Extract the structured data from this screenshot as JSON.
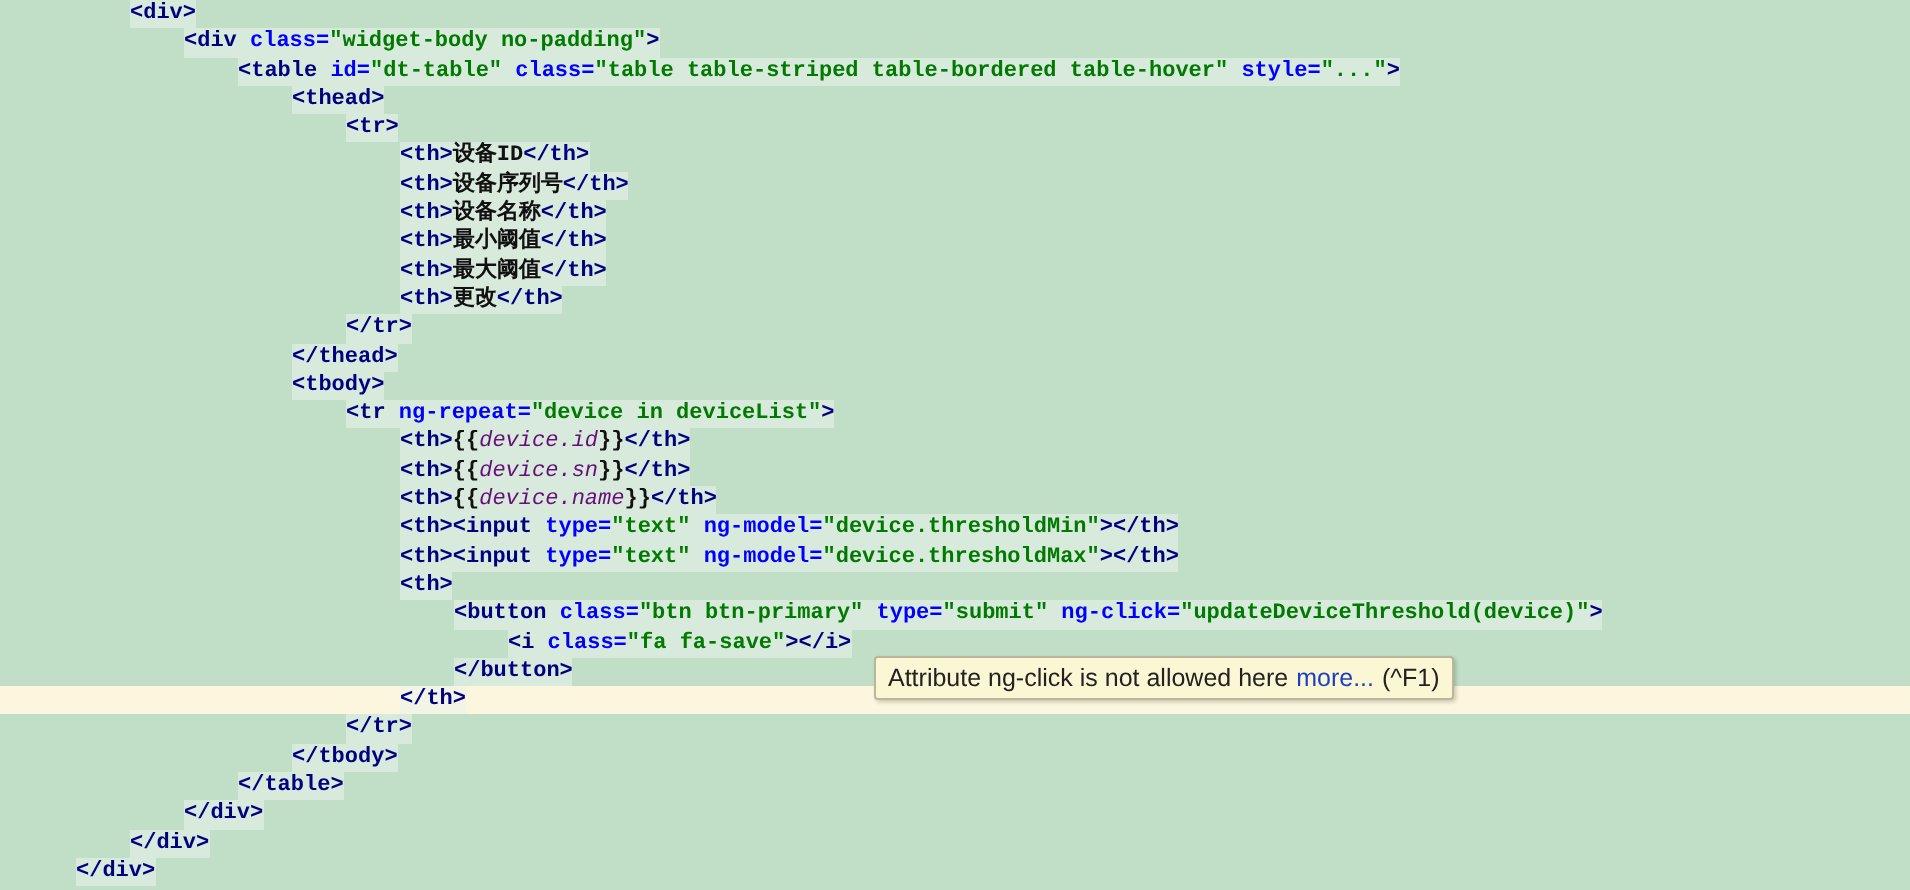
{
  "editor": {
    "lines": [
      {
        "children": [
          {
            "current": false,
            "tokens": [
              {
                "kind": "tag",
                "text": "<div>"
              }
            ],
            "children": [
              {
                "current": false,
                "tokens": [
                  {
                    "kind": "tag",
                    "text": "<div"
                  },
                  {
                    "kind": "attr",
                    "text": " class="
                  },
                  {
                    "kind": "value",
                    "text": "\"widget-body no-padding\""
                  },
                  {
                    "kind": "tag",
                    "text": ">"
                  }
                ],
                "children": [
                  {
                    "current": false,
                    "tokens": [
                      {
                        "kind": "tag",
                        "text": "<table"
                      },
                      {
                        "kind": "attr",
                        "text": " id="
                      },
                      {
                        "kind": "value",
                        "text": "\"dt-table\""
                      },
                      {
                        "kind": "attr",
                        "text": " class="
                      },
                      {
                        "kind": "value",
                        "text": "\"table table-striped table-bordered table-hover\""
                      },
                      {
                        "kind": "attr",
                        "text": " style="
                      },
                      {
                        "kind": "value",
                        "text": "\"...\""
                      },
                      {
                        "kind": "tag",
                        "text": ">"
                      }
                    ],
                    "children": [
                      {
                        "current": false,
                        "tokens": [
                          {
                            "kind": "tag",
                            "text": "<thead>"
                          }
                        ],
                        "children": [
                          {
                            "current": false,
                            "tokens": [
                              {
                                "kind": "tag",
                                "text": "<tr>"
                              }
                            ],
                            "children": [
                              {
                                "current": false,
                                "tokens": [
                                  {
                                    "kind": "tag",
                                    "text": "<th>"
                                  },
                                  {
                                    "kind": "text",
                                    "text": "设备ID"
                                  },
                                  {
                                    "kind": "tag",
                                    "text": "</th>"
                                  }
                                ]
                              },
                              {
                                "current": false,
                                "tokens": [
                                  {
                                    "kind": "tag",
                                    "text": "<th>"
                                  },
                                  {
                                    "kind": "text",
                                    "text": "设备序列号"
                                  },
                                  {
                                    "kind": "tag",
                                    "text": "</th>"
                                  }
                                ]
                              },
                              {
                                "current": false,
                                "tokens": [
                                  {
                                    "kind": "tag",
                                    "text": "<th>"
                                  },
                                  {
                                    "kind": "text",
                                    "text": "设备名称"
                                  },
                                  {
                                    "kind": "tag",
                                    "text": "</th>"
                                  }
                                ]
                              },
                              {
                                "current": false,
                                "tokens": [
                                  {
                                    "kind": "tag",
                                    "text": "<th>"
                                  },
                                  {
                                    "kind": "text",
                                    "text": "最小阈值"
                                  },
                                  {
                                    "kind": "tag",
                                    "text": "</th>"
                                  }
                                ]
                              },
                              {
                                "current": false,
                                "tokens": [
                                  {
                                    "kind": "tag",
                                    "text": "<th>"
                                  },
                                  {
                                    "kind": "text",
                                    "text": "最大阈值"
                                  },
                                  {
                                    "kind": "tag",
                                    "text": "</th>"
                                  }
                                ]
                              },
                              {
                                "current": false,
                                "tokens": [
                                  {
                                    "kind": "tag",
                                    "text": "<th>"
                                  },
                                  {
                                    "kind": "text",
                                    "text": "更改"
                                  },
                                  {
                                    "kind": "tag",
                                    "text": "</th>"
                                  }
                                ]
                              }
                            ]
                          },
                          {
                            "current": false,
                            "tokens": [
                              {
                                "kind": "tag",
                                "text": "</tr>"
                              }
                            ]
                          }
                        ]
                      },
                      {
                        "current": false,
                        "tokens": [
                          {
                            "kind": "tag",
                            "text": "</thead>"
                          }
                        ]
                      },
                      {
                        "current": false,
                        "tokens": [
                          {
                            "kind": "tag",
                            "text": "<tbody>"
                          }
                        ],
                        "children": [
                          {
                            "current": false,
                            "tokens": [
                              {
                                "kind": "tag",
                                "text": "<tr"
                              },
                              {
                                "kind": "attr",
                                "text": " ng-repeat="
                              },
                              {
                                "kind": "value",
                                "text": "\"device in deviceList\""
                              },
                              {
                                "kind": "tag",
                                "text": ">"
                              }
                            ],
                            "children": [
                              {
                                "current": false,
                                "tokens": [
                                  {
                                    "kind": "tag",
                                    "text": "<th>"
                                  },
                                  {
                                    "kind": "text",
                                    "text": "{{"
                                  },
                                  {
                                    "kind": "expr",
                                    "text": "device.id"
                                  },
                                  {
                                    "kind": "text",
                                    "text": "}}"
                                  },
                                  {
                                    "kind": "tag",
                                    "text": "</th>"
                                  }
                                ]
                              },
                              {
                                "current": false,
                                "tokens": [
                                  {
                                    "kind": "tag",
                                    "text": "<th>"
                                  },
                                  {
                                    "kind": "text",
                                    "text": "{{"
                                  },
                                  {
                                    "kind": "expr",
                                    "text": "device.sn"
                                  },
                                  {
                                    "kind": "text",
                                    "text": "}}"
                                  },
                                  {
                                    "kind": "tag",
                                    "text": "</th>"
                                  }
                                ]
                              },
                              {
                                "current": false,
                                "tokens": [
                                  {
                                    "kind": "tag",
                                    "text": "<th>"
                                  },
                                  {
                                    "kind": "text",
                                    "text": "{{"
                                  },
                                  {
                                    "kind": "expr",
                                    "text": "device.name"
                                  },
                                  {
                                    "kind": "text",
                                    "text": "}}"
                                  },
                                  {
                                    "kind": "tag",
                                    "text": "</th>"
                                  }
                                ]
                              },
                              {
                                "current": false,
                                "tokens": [
                                  {
                                    "kind": "tag",
                                    "text": "<th><input"
                                  },
                                  {
                                    "kind": "attr",
                                    "text": " type="
                                  },
                                  {
                                    "kind": "value",
                                    "text": "\"text\""
                                  },
                                  {
                                    "kind": "attr",
                                    "text": " ng-model="
                                  },
                                  {
                                    "kind": "value",
                                    "text": "\"device.thresholdMin\""
                                  },
                                  {
                                    "kind": "tag",
                                    "text": "></th>"
                                  }
                                ]
                              },
                              {
                                "current": false,
                                "tokens": [
                                  {
                                    "kind": "tag",
                                    "text": "<th><input"
                                  },
                                  {
                                    "kind": "attr",
                                    "text": " type="
                                  },
                                  {
                                    "kind": "value",
                                    "text": "\"text\""
                                  },
                                  {
                                    "kind": "attr",
                                    "text": " ng-model="
                                  },
                                  {
                                    "kind": "value",
                                    "text": "\"device.thresholdMax\""
                                  },
                                  {
                                    "kind": "tag",
                                    "text": "></th>"
                                  }
                                ]
                              },
                              {
                                "current": false,
                                "tokens": [
                                  {
                                    "kind": "tag",
                                    "text": "<th>"
                                  }
                                ],
                                "children": [
                                  {
                                    "current": false,
                                    "tokens": [
                                      {
                                        "kind": "tag",
                                        "text": "<button"
                                      },
                                      {
                                        "kind": "attr",
                                        "text": " class="
                                      },
                                      {
                                        "kind": "value",
                                        "text": "\"btn btn-primary\""
                                      },
                                      {
                                        "kind": "attr",
                                        "text": " type="
                                      },
                                      {
                                        "kind": "value",
                                        "text": "\"submit\""
                                      },
                                      {
                                        "kind": "attr",
                                        "text": " ng-click="
                                      },
                                      {
                                        "kind": "value",
                                        "text": "\"updateDeviceThreshold(device)\""
                                      },
                                      {
                                        "kind": "tag",
                                        "text": ">"
                                      }
                                    ],
                                    "children": [
                                      {
                                        "current": false,
                                        "tokens": [
                                          {
                                            "kind": "tag",
                                            "text": "<i"
                                          },
                                          {
                                            "kind": "attr",
                                            "text": " class="
                                          },
                                          {
                                            "kind": "value",
                                            "text": "\"fa fa-save\""
                                          },
                                          {
                                            "kind": "tag",
                                            "text": "></i>"
                                          }
                                        ]
                                      }
                                    ]
                                  },
                                  {
                                    "current": false,
                                    "tokens": [
                                      {
                                        "kind": "tag",
                                        "text": "</button>"
                                      }
                                    ]
                                  }
                                ]
                              },
                              {
                                "current": true,
                                "tokens": [
                                  {
                                    "kind": "tag",
                                    "text": "</th>"
                                  }
                                ]
                              }
                            ]
                          },
                          {
                            "current": false,
                            "tokens": [
                              {
                                "kind": "tag",
                                "text": "</tr>"
                              }
                            ]
                          }
                        ]
                      },
                      {
                        "current": false,
                        "tokens": [
                          {
                            "kind": "tag",
                            "text": "</tbody>"
                          }
                        ]
                      }
                    ]
                  },
                  {
                    "current": false,
                    "tokens": [
                      {
                        "kind": "tag",
                        "text": "</table>"
                      }
                    ]
                  }
                ]
              },
              {
                "current": false,
                "tokens": [
                  {
                    "kind": "tag",
                    "text": "</div>"
                  }
                ]
              }
            ]
          },
          {
            "current": false,
            "tokens": [
              {
                "kind": "tag",
                "text": "</div>"
              }
            ]
          }
        ]
      },
      {
        "current": false,
        "tokens": [
          {
            "kind": "tag",
            "text": "</div>"
          }
        ]
      }
    ]
  },
  "tooltip": {
    "message": "Attribute ng-click is not allowed here",
    "link": "more...",
    "shortcut": "(^F1)"
  }
}
